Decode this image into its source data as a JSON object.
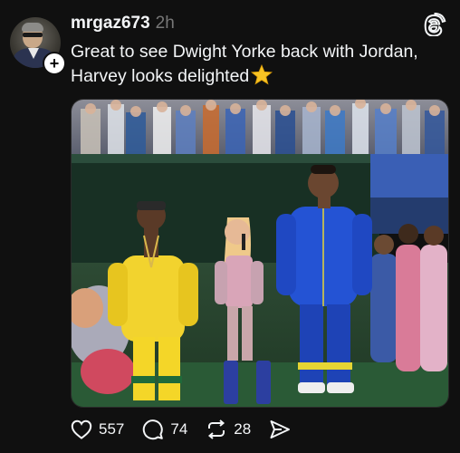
{
  "post": {
    "username": "mrgaz673",
    "timestamp": "2h",
    "text_line1": "Great to see Dwight Yorke back with Jordan,",
    "text_line2": "Harvey looks delighted",
    "emoji": "star-emoji"
  },
  "actions": {
    "likes": "557",
    "comments": "74",
    "reposts": "28"
  },
  "icons": {
    "app_logo": "threads-logo-icon",
    "like": "heart-icon",
    "comment": "comment-bubble-icon",
    "repost": "repost-icon",
    "share": "send-icon",
    "follow": "plus-icon"
  },
  "colors": {
    "background": "#101010",
    "text": "#f3f5f7",
    "muted": "#777777"
  }
}
